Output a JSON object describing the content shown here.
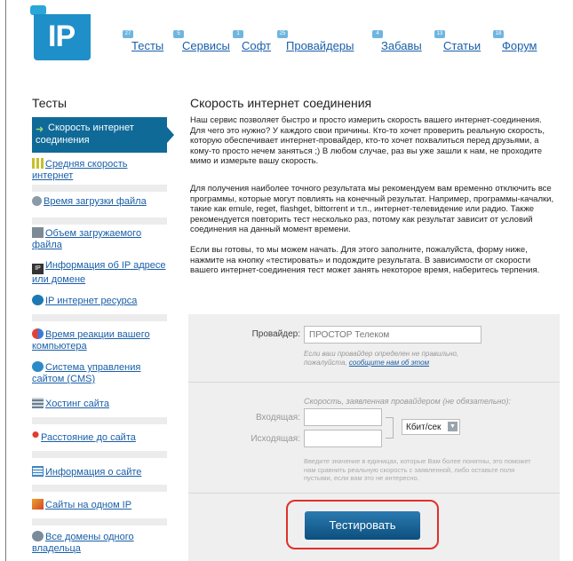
{
  "logo": {
    "text": "IP"
  },
  "nav": [
    {
      "label": "Тесты",
      "badge": "27"
    },
    {
      "label": "Сервисы",
      "badge": "5"
    },
    {
      "label": "Софт",
      "badge": "1"
    },
    {
      "label": "Провайдеры",
      "badge": "25"
    },
    {
      "label": "Забавы",
      "badge": "4"
    },
    {
      "label": "Статьи",
      "badge": "13"
    },
    {
      "label": "Форум",
      "badge": "18"
    }
  ],
  "sidebar": {
    "title": "Тесты",
    "items": [
      {
        "label": "Скорость интернет соединения",
        "icon": "speed-arrow-icon",
        "active": true
      },
      {
        "label": "Средняя скорость интернет",
        "icon": "bars-icon"
      },
      {
        "label": "Время загрузки файла",
        "icon": "clock-icon"
      },
      {
        "label": "Объем загружаемого файла",
        "icon": "file-size-icon"
      },
      {
        "label": "Информация об IP адресе или домене",
        "icon": "ip-icon"
      },
      {
        "label": "IP интернет ресурса",
        "icon": "globe-ip-icon"
      },
      {
        "label": "Время реакции вашего компьютера",
        "icon": "reaction-icon"
      },
      {
        "label": "Система управления сайтом (CMS)",
        "icon": "cms-icon"
      },
      {
        "label": "Хостинг сайта",
        "icon": "hosting-icon"
      },
      {
        "label": "Расстояние до сайта",
        "icon": "pin-icon"
      },
      {
        "label": "Информация о сайте",
        "icon": "info-doc-icon"
      },
      {
        "label": "Сайты на одном IP",
        "icon": "sites-icon"
      },
      {
        "label": "Все домены одного владельца",
        "icon": "domains-icon"
      }
    ]
  },
  "main": {
    "title": "Скорость интернет соединения",
    "p1": "Наш сервис позволяет быстро и просто измерить скорость вашего интернет-соединения. Для чего это нужно? У каждого свои причины. Кто-то хочет проверить реальную скорость, которую обеспечивает интернет-провайдер, кто-то хочет похвалиться перед друзьями, а кому-то просто нечем заняться ;) В любом случае, раз вы уже зашли к нам, не проходите мимо и измерьте вашу скорость.",
    "p2": "Для получения наиболее точного результата мы рекомендуем вам временно отключить все программы, которые могут повлиять на конечный результат. Например, программы-качалки, такие как emule, reget, flashget, bittorrent и т.п., интернет-телевидение или радио. Также рекомендуется повторить тест несколько раз, потому как результат зависит от условий соединения на данный момент времени.",
    "p3": "Если вы готовы, то мы можем начать. Для этого заполните, пожалуйста, форму ниже, нажмите на кнопку «тестировать» и подождите результата. В зависимости от скорости вашего интернет-соединения тест может занять некоторое время, наберитесь терпения."
  },
  "form": {
    "provider_label": "Провайдер:",
    "provider_placeholder": "ПРОСТОР Телеком",
    "provider_note": "Если ваш провайдер определен не правильно, пожалуйста,",
    "provider_link": "сообщите нам об этом",
    "speed_caption": "Скорость, заявленная провайдером (не обязательно):",
    "incoming_label": "Входящая:",
    "outgoing_label": "Исходящая:",
    "unit": "Кбит/сек",
    "units_note": "Введите значение в единицах, которые Вам более понятны, это поможет нам сравнить реальную скорость с заявленной, либо оставьте поля пустыми, если вам это не интересно.",
    "submit": "Тестировать"
  }
}
